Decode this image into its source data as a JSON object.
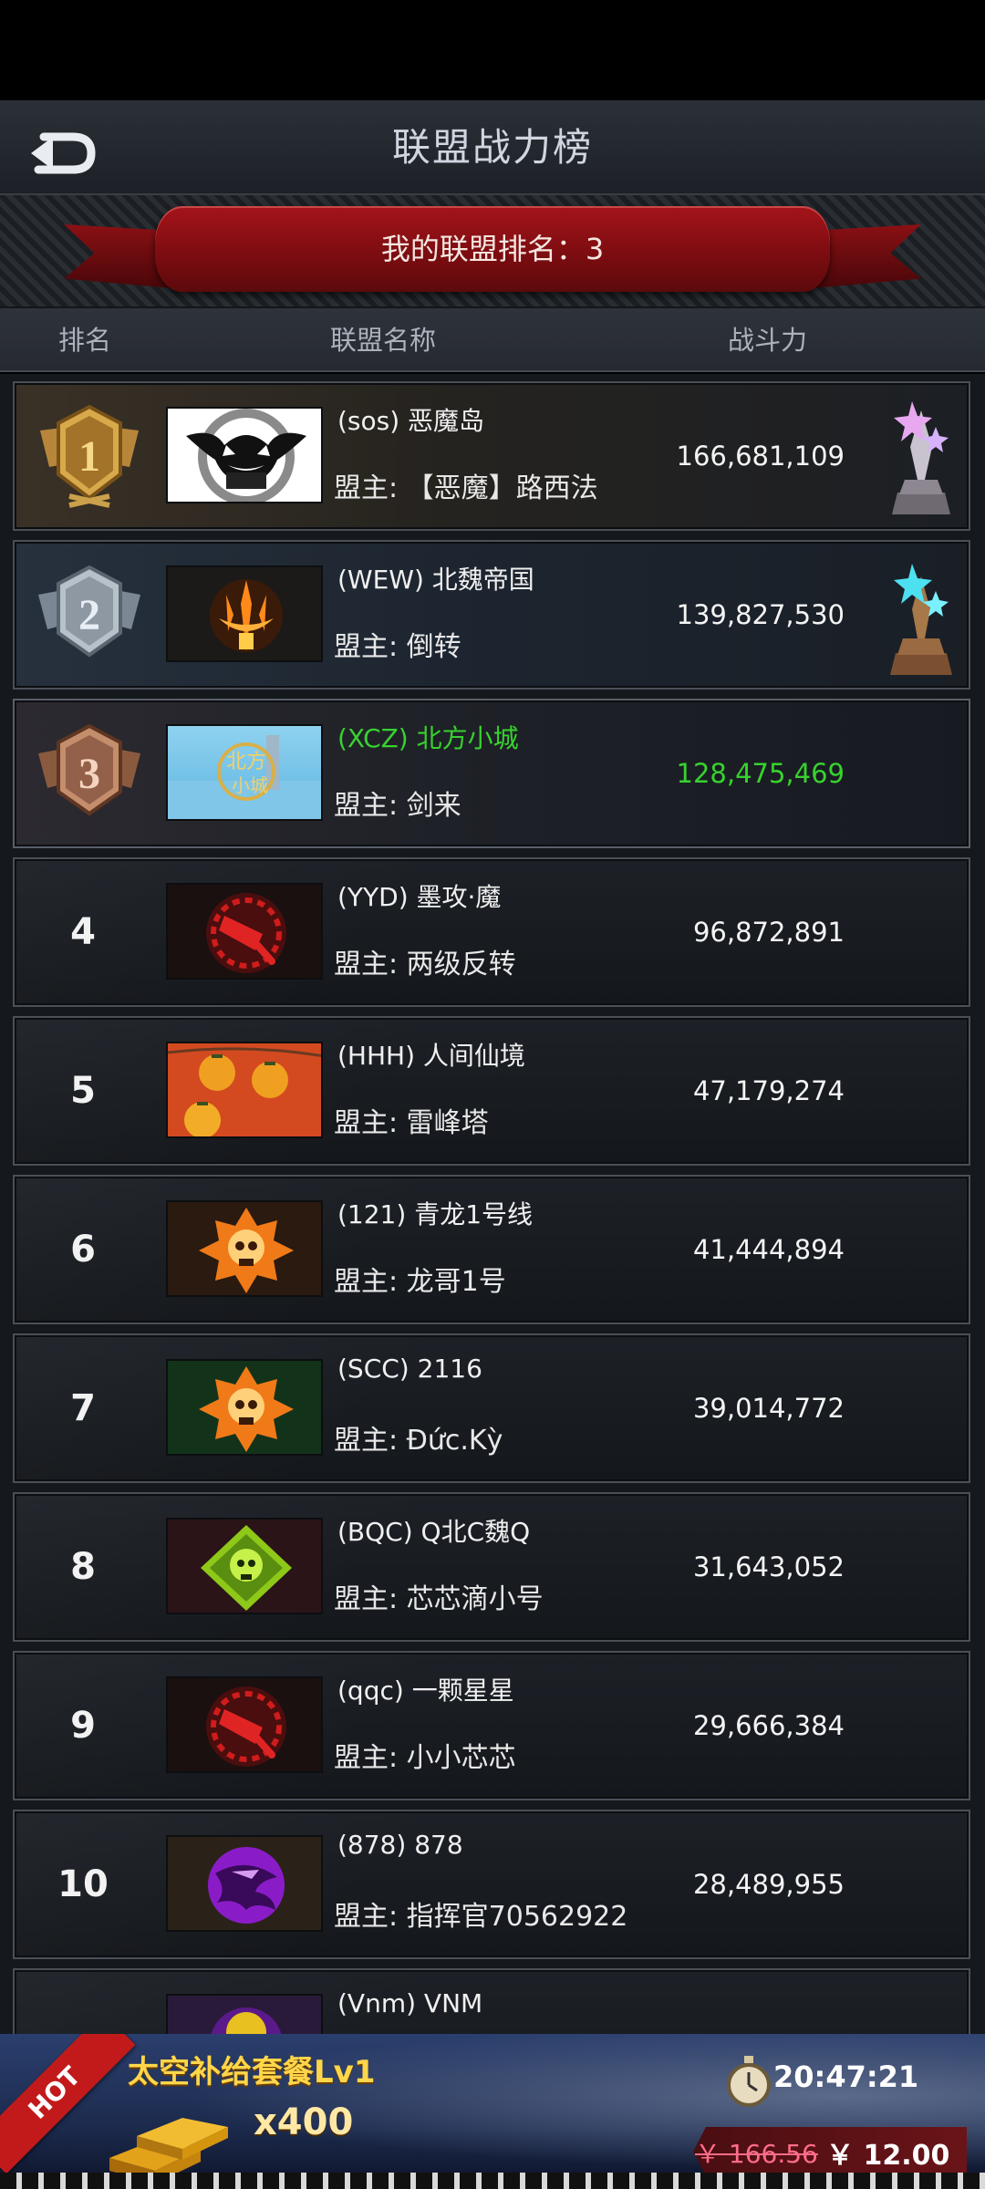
{
  "header": {
    "title": "联盟战力榜",
    "back_icon": "back-arrow-icon"
  },
  "banner": {
    "my_rank_text": "我的联盟排名：3"
  },
  "columns": {
    "rank": "排名",
    "name": "联盟名称",
    "power": "战斗力"
  },
  "rows": [
    {
      "rank": "1",
      "name": "(sos) 恶魔岛",
      "leader": "盟主: 【恶魔】路西法",
      "power": "166,681,109",
      "emblem": "demon-bat-emblem",
      "medal": "gold",
      "trophy": "silver-trophy"
    },
    {
      "rank": "2",
      "name": "(WEW) 北魏帝国",
      "leader": "盟主: 倒转",
      "power": "139,827,530",
      "emblem": "trident-flame-emblem",
      "medal": "silver",
      "trophy": "bronze-trophy"
    },
    {
      "rank": "3",
      "name": "(XCZ) 北方小城",
      "leader": "盟主: 剑来",
      "power": "128,475,469",
      "emblem": "xcz-city-emblem",
      "medal": "bronze",
      "mine": true
    },
    {
      "rank": "4",
      "name": "(YYD) 墨攻·魔",
      "leader": "盟主: 两级反转",
      "power": "96,872,891",
      "emblem": "red-cleaver-emblem"
    },
    {
      "rank": "5",
      "name": "(HHH) 人间仙境",
      "leader": "盟主: 雷峰塔",
      "power": "47,179,274",
      "emblem": "persimmon-photo-emblem"
    },
    {
      "rank": "6",
      "name": "(121) 青龙1号线",
      "leader": "盟主: 龙哥1号",
      "power": "41,444,894",
      "emblem": "orange-skull-emblem"
    },
    {
      "rank": "7",
      "name": "(SCC) 2116",
      "leader": "盟主: Đức.Kỳ",
      "power": "39,014,772",
      "emblem": "orange-skull-green-emblem"
    },
    {
      "rank": "8",
      "name": "(BQC) Q北C魏Q",
      "leader": "盟主: 芯芯滴小号",
      "power": "31,643,052",
      "emblem": "green-skull-emblem"
    },
    {
      "rank": "9",
      "name": "(qqc) 一颗星星",
      "leader": "盟主: 小小芯芯",
      "power": "29,666,384",
      "emblem": "red-cleaver-emblem"
    },
    {
      "rank": "10",
      "name": "(878) 878",
      "leader": "盟主: 指挥官70562922",
      "power": "28,489,955",
      "emblem": "purple-eagle-emblem"
    },
    {
      "rank": "",
      "name": "(Vnm) VNM",
      "leader": "",
      "power": "",
      "emblem": "yellow-emblem"
    }
  ],
  "ad": {
    "hot_label": "HOT",
    "title": "太空补给套餐Lv1",
    "quantity": "x400",
    "timer": "20:47:21",
    "old_price": "￥ 166.56",
    "new_price": "￥ 12.00",
    "icons": [
      "gold-bars-icon",
      "stopwatch-icon"
    ]
  },
  "colors": {
    "highlight_green": "#38d22f",
    "ribbon_red": "#a4141a",
    "ad_title_yellow": "#ffd64a"
  }
}
